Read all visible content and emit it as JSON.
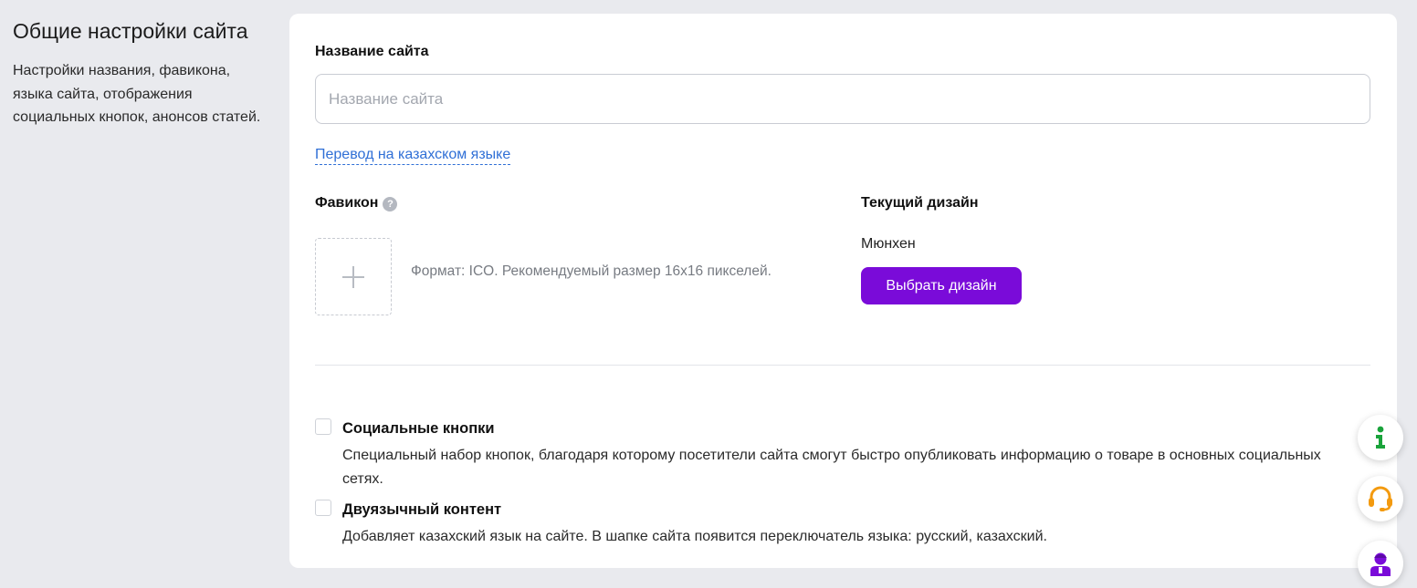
{
  "sidebar": {
    "title": "Общие настройки сайта",
    "description": "Настройки названия, фавикона, языка сайта, отображения социальных кнопок, анонсов статей."
  },
  "site_name": {
    "label": "Название сайта",
    "placeholder": "Название сайта",
    "value": ""
  },
  "translation_link": "Перевод на казахском языке",
  "favicon": {
    "label": "Фавикон",
    "help": "?",
    "hint": "Формат: ICO. Рекомендуемый размер 16x16 пикселей."
  },
  "design": {
    "label": "Текущий дизайн",
    "current": "Мюнхен",
    "button": "Выбрать дизайн"
  },
  "options": [
    {
      "title": "Социальные кнопки",
      "description": "Специальный набор кнопок, благодаря которому посетители сайта смогут быстро опубликовать информацию о товаре в основных социальных сетях.",
      "checked": false
    },
    {
      "title": "Двуязычный контент",
      "description": "Добавляет казахский язык на сайте. В шапке сайта появится переключатель языка: русский, казахский.",
      "checked": false
    }
  ],
  "floating_buttons": [
    {
      "icon": "info-icon",
      "color": "#1aa33b"
    },
    {
      "icon": "headset-icon",
      "color": "#f39a0f"
    },
    {
      "icon": "manager-icon",
      "color": "#7a0bd9"
    }
  ],
  "colors": {
    "accent": "#7a0bd9",
    "link": "#2f6fd6",
    "background": "#e9eaee"
  }
}
